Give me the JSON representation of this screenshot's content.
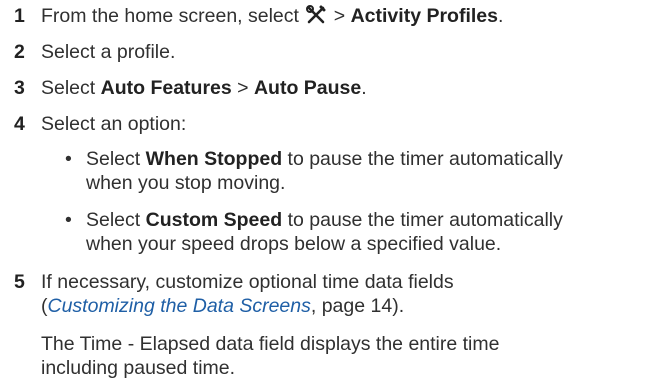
{
  "steps": [
    {
      "number": "1",
      "lines": [
        {
          "pre": "From the home screen, select",
          "icon": "wrench-screwdriver-icon",
          "mid": " > ",
          "bold": "Activity Profiles",
          "post": "."
        }
      ]
    },
    {
      "number": "2",
      "text": "Select a profile."
    },
    {
      "number": "3",
      "pre": "Select ",
      "bold1": "Auto Features",
      "mid": " > ",
      "bold2": "Auto Pause",
      "post": "."
    },
    {
      "number": "4",
      "text": "Select an option:",
      "bullets": [
        {
          "pre": "Select ",
          "bold": "When Stopped",
          "post": " to pause the timer automatically",
          "line2": "when you stop moving."
        },
        {
          "pre": "Select ",
          "bold": "Custom Speed",
          "post": " to pause the timer automatically",
          "line2": "when your speed drops below a specified value."
        }
      ]
    },
    {
      "number": "5",
      "line1": "If necessary, customize optional time data fields",
      "open_paren": "(",
      "link_text": "Customizing the Data Screens",
      "link_post": ", page 14).",
      "note_line1": "The Time - Elapsed data field displays the entire time",
      "note_line2": "including paused time."
    }
  ],
  "bullet_glyph": "•"
}
